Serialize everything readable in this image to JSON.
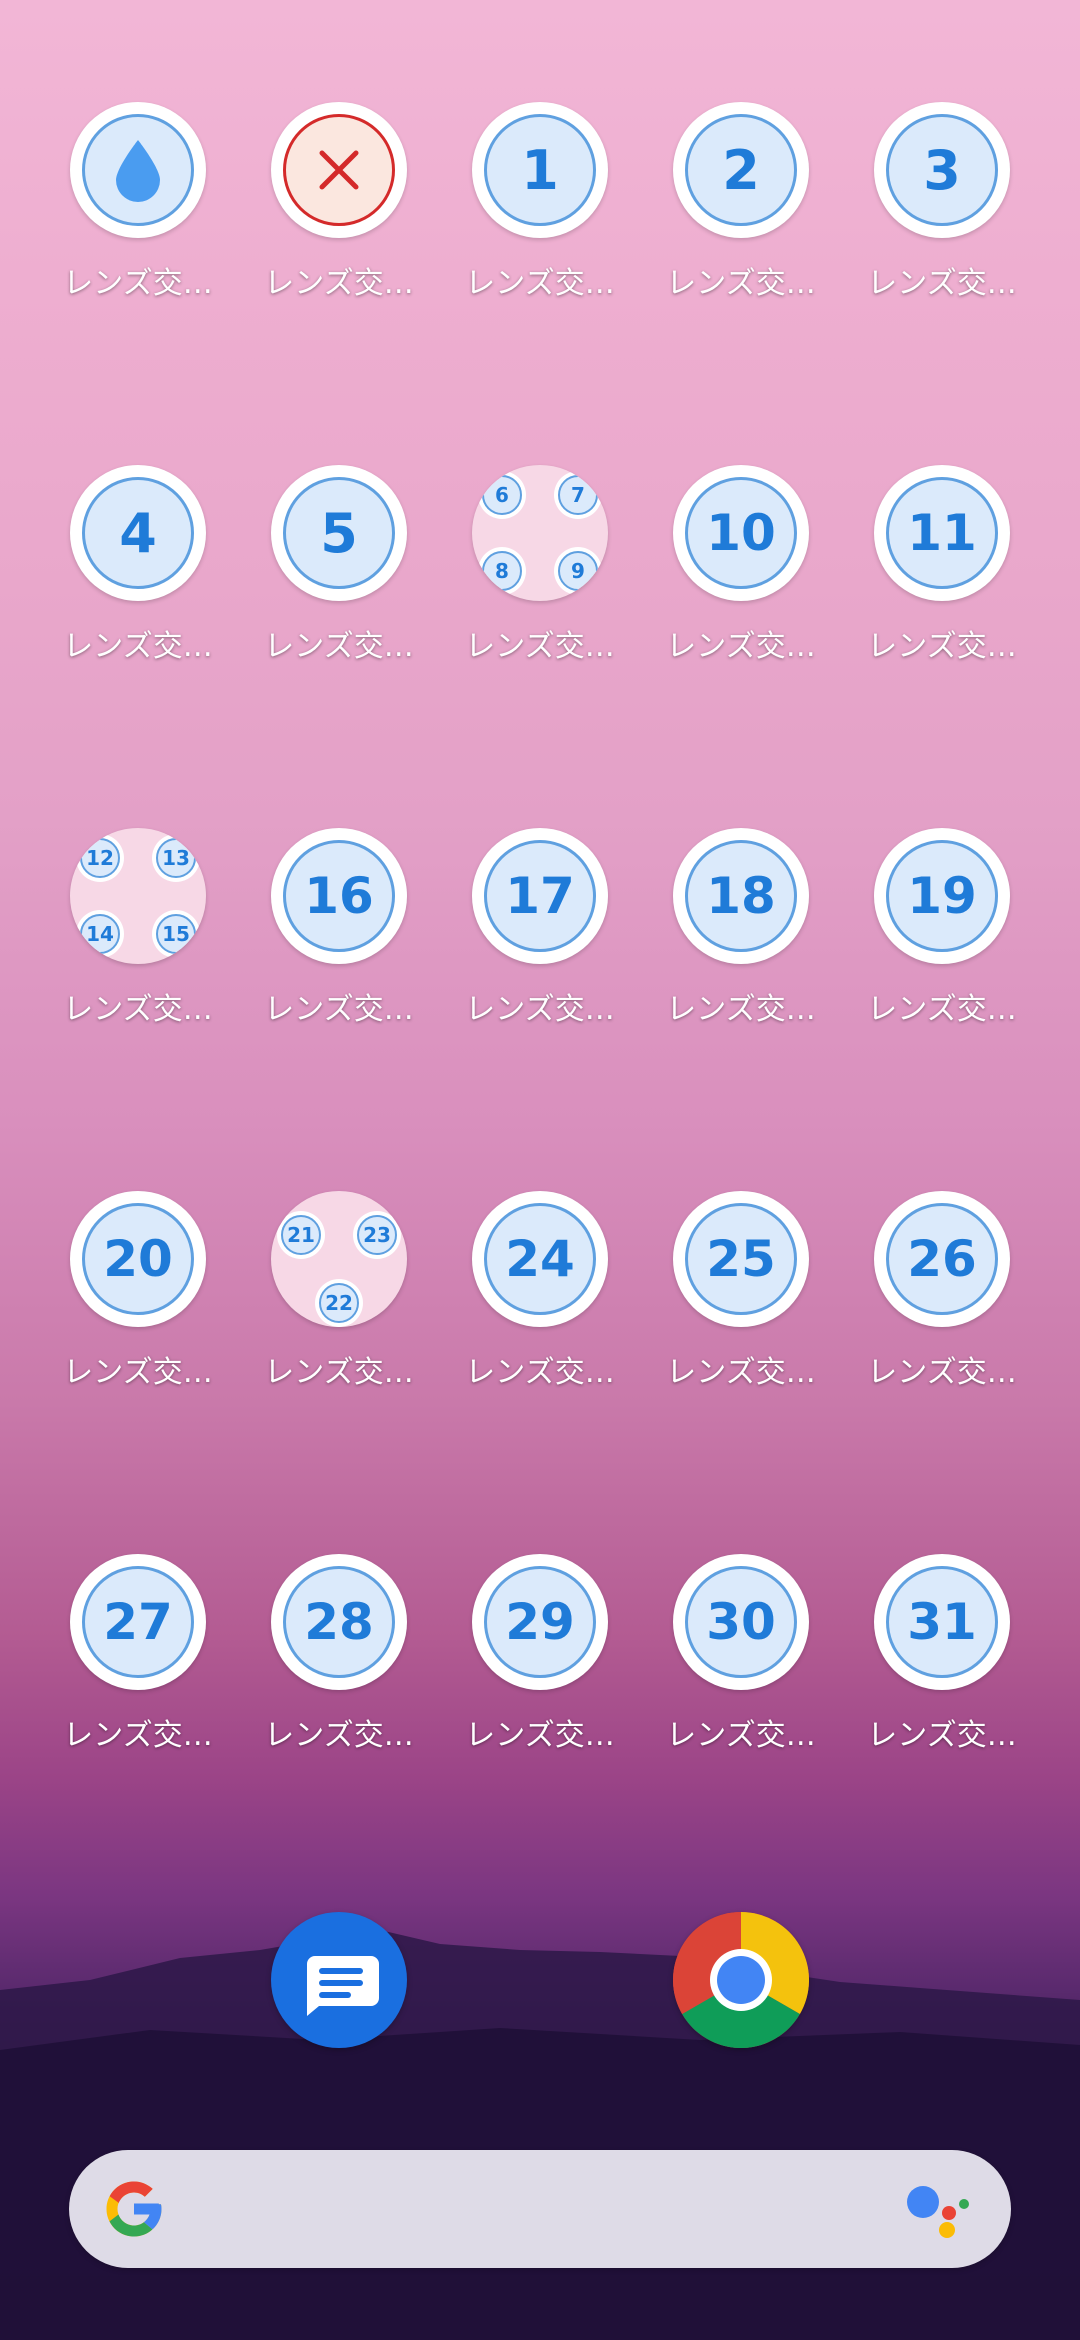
{
  "home_screen": {
    "apps": [
      {
        "type": "single",
        "variant": "drop",
        "text": "",
        "label": "レンズ交…"
      },
      {
        "type": "single",
        "variant": "red-x",
        "text": "",
        "label": "レンズ交…"
      },
      {
        "type": "single",
        "variant": "number",
        "text": "1",
        "label": "レンズ交…"
      },
      {
        "type": "single",
        "variant": "number",
        "text": "2",
        "label": "レンズ交…"
      },
      {
        "type": "single",
        "variant": "number",
        "text": "3",
        "label": "レンズ交…"
      },
      {
        "type": "single",
        "variant": "number",
        "text": "4",
        "label": "レンズ交…"
      },
      {
        "type": "single",
        "variant": "number",
        "text": "5",
        "label": "レンズ交…"
      },
      {
        "type": "folder",
        "items": [
          "6",
          "7",
          "8",
          "9"
        ],
        "label": "レンズ交…"
      },
      {
        "type": "single",
        "variant": "number",
        "text": "10",
        "label": "レンズ交…"
      },
      {
        "type": "single",
        "variant": "number",
        "text": "11",
        "label": "レンズ交…"
      },
      {
        "type": "folder",
        "items": [
          "12",
          "13",
          "14",
          "15"
        ],
        "label": "レンズ交…"
      },
      {
        "type": "single",
        "variant": "number",
        "text": "16",
        "label": "レンズ交…"
      },
      {
        "type": "single",
        "variant": "number",
        "text": "17",
        "label": "レンズ交…"
      },
      {
        "type": "single",
        "variant": "number",
        "text": "18",
        "label": "レンズ交…"
      },
      {
        "type": "single",
        "variant": "number",
        "text": "19",
        "label": "レンズ交…"
      },
      {
        "type": "single",
        "variant": "number",
        "text": "20",
        "label": "レンズ交…"
      },
      {
        "type": "folder",
        "items": [
          "21",
          "23",
          "22"
        ],
        "label": "レンズ交…"
      },
      {
        "type": "single",
        "variant": "number",
        "text": "24",
        "label": "レンズ交…"
      },
      {
        "type": "single",
        "variant": "number",
        "text": "25",
        "label": "レンズ交…"
      },
      {
        "type": "single",
        "variant": "number",
        "text": "26",
        "label": "レンズ交…"
      },
      {
        "type": "single",
        "variant": "number",
        "text": "27",
        "label": "レンズ交…"
      },
      {
        "type": "single",
        "variant": "number",
        "text": "28",
        "label": "レンズ交…"
      },
      {
        "type": "single",
        "variant": "number",
        "text": "29",
        "label": "レンズ交…"
      },
      {
        "type": "single",
        "variant": "number",
        "text": "30",
        "label": "レンズ交…"
      },
      {
        "type": "single",
        "variant": "number",
        "text": "31",
        "label": "レンズ交…"
      }
    ]
  },
  "dock": [
    {
      "name": "messages-app-icon"
    },
    {
      "name": "chrome-app-icon"
    }
  ],
  "search_bar": {
    "logo_icon": "google-g-icon",
    "assistant_icon": "google-assistant-icon"
  },
  "colors": {
    "icon_blue": "#1f7bd8",
    "icon_fill": "#dbeafb",
    "icon_border": "#5fa0e0",
    "cancel_red": "#d42a2a",
    "folder_bg": "#f7d8e6",
    "messages_blue": "#1a6fe0",
    "search_bg": "#dedbe7"
  }
}
